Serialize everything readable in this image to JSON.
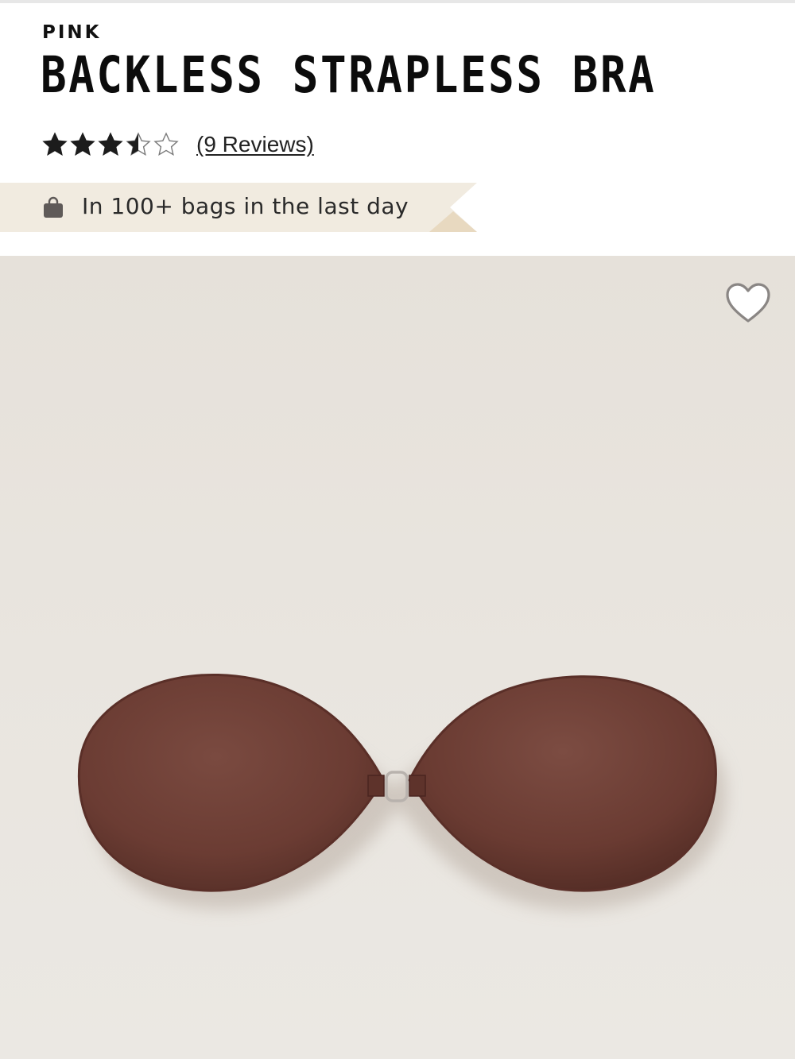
{
  "product": {
    "brand": "PINK",
    "title": "BACKLESS STRAPLESS BRA",
    "rating": 3.5,
    "rating_max": 5,
    "reviews_label": "(9 Reviews)"
  },
  "social_proof": {
    "text": "In 100+ bags in the last day",
    "icon": "shopping-bag-icon"
  },
  "image": {
    "icon_favorite": "heart-icon",
    "product_color": "#6b3d35",
    "background_color": "#e8e4de"
  },
  "colors": {
    "banner": "#f1ebe0",
    "banner_fold": "#e8dcc6",
    "star": "#1c1c1c",
    "bag_icon": "#5f5a58"
  }
}
